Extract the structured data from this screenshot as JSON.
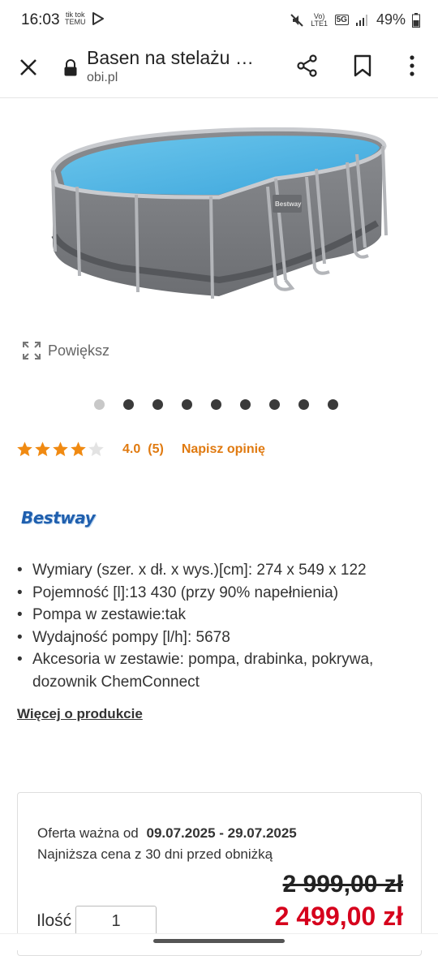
{
  "status_bar": {
    "time": "16:03",
    "left_icons": [
      "tiktok-temu-icon",
      "play-icon"
    ],
    "tiktok_label": "tik tok",
    "temu_label": "TEMU",
    "volte_label": "Vo) LTE1",
    "network_label": "5G",
    "battery": "49%"
  },
  "browser": {
    "title": "Basen na stelażu …",
    "domain": "obi.pl"
  },
  "product": {
    "image_icon": "pool-image",
    "zoom_label": "Powiększ",
    "gallery_dots": 9,
    "gallery_active_index": 0,
    "rating": {
      "stars": 4,
      "value": "4.0",
      "count": "(5)",
      "write_review": "Napisz opinię"
    },
    "brand": "Bestway",
    "features": [
      "Wymiary (szer. x dł. x wys.)[cm]: 274 x 549 x 122",
      "Pojemność [l]:13 430 (przy 90% napełnienia)",
      "Pompa w zestawie:tak",
      "Wydajność pompy [l/h]: 5678",
      "Akcesoria w zestawie: pompa, drabinka, pokrywa, dozownik ChemConnect"
    ],
    "more_link": "Więcej o produkcie"
  },
  "offer": {
    "valid_label": "Oferta ważna od",
    "valid_dates": "09.07.2025 - 29.07.2025",
    "lowest_price_note": "Najniższa cena z 30 dni przed obniżką",
    "old_price": "2 999,00 zł",
    "new_price": "2 499,00 zł",
    "quantity_label": "Ilość",
    "quantity_value": "1"
  },
  "colors": {
    "accent_orange": "#e07a10",
    "price_red": "#d6001c",
    "brand_blue": "#1f5fae",
    "star_orange": "#f08a12"
  }
}
